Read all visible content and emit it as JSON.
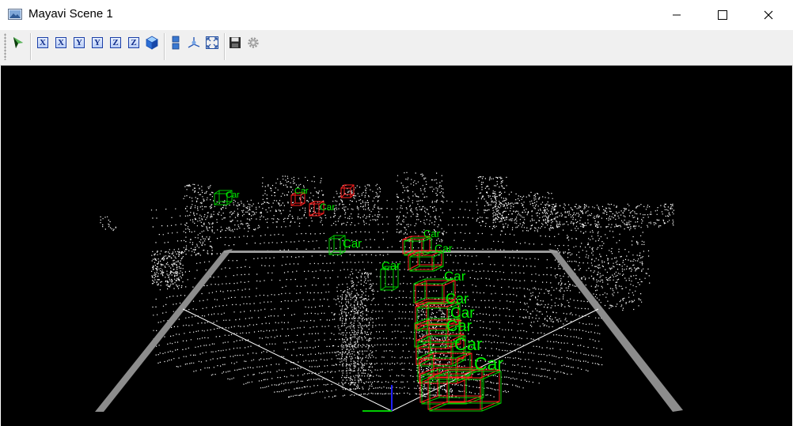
{
  "window": {
    "title": "Mayavi Scene 1",
    "icons": {
      "app": "mayavi-scene-icon",
      "minimize": "minimize-icon",
      "maximize": "maximize-icon",
      "close": "close-icon"
    }
  },
  "toolbar": {
    "buttons": [
      {
        "name": "mayavi-pipeline-button",
        "icon": "mayavi-pipeline-icon"
      },
      {
        "name": "view-x-plus-button",
        "label": "X"
      },
      {
        "name": "view-x-minus-button",
        "label": "X"
      },
      {
        "name": "view-y-plus-button",
        "label": "Y"
      },
      {
        "name": "view-y-minus-button",
        "label": "Y"
      },
      {
        "name": "view-z-plus-button",
        "label": "Z"
      },
      {
        "name": "view-z-minus-button",
        "label": "Z"
      },
      {
        "name": "isometric-view-button",
        "icon": "cube-icon"
      },
      {
        "name": "parallel-projection-button",
        "icon": "parallel-projection-icon"
      },
      {
        "name": "toggle-axes-button",
        "icon": "axes-icon"
      },
      {
        "name": "full-screen-button",
        "icon": "fullscreen-icon"
      },
      {
        "name": "save-scene-button",
        "icon": "save-icon"
      },
      {
        "name": "configure-scene-button",
        "icon": "gear-icon"
      }
    ]
  },
  "scene": {
    "background": "#000000",
    "point_color": "#ffffff",
    "frustum_color": "#9a9a9a",
    "label_color": "#00ee00",
    "box_colors": {
      "prediction": "#ff2020",
      "ground_truth": "#00cc00"
    },
    "labels": [
      "Car",
      "Car",
      "Car",
      "Car",
      "Car",
      "Car",
      "Car",
      "Car",
      "Car",
      "Car",
      "Car",
      "Car",
      "Car",
      "Car",
      "Car"
    ]
  }
}
